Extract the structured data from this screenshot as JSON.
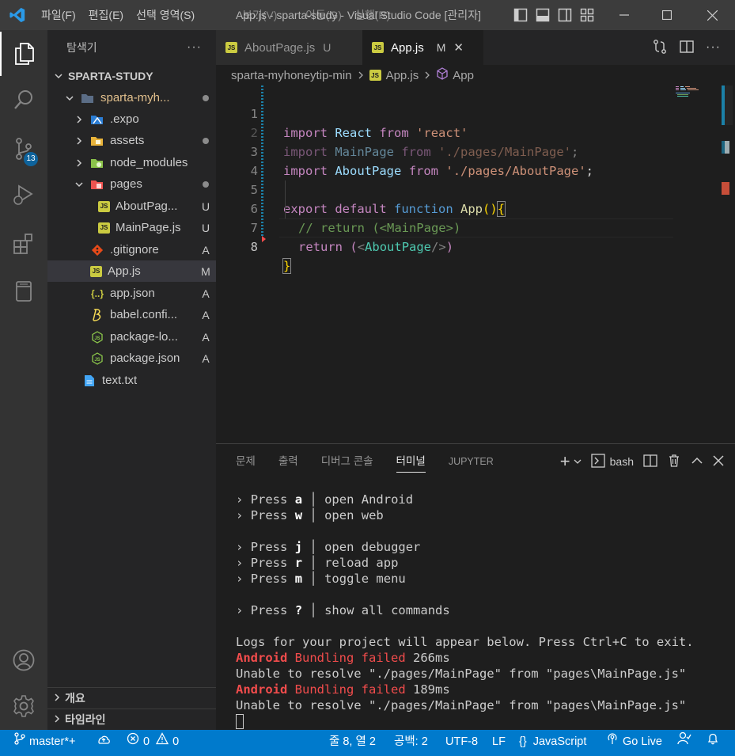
{
  "window": {
    "title": "App.js - sparta-study - Visual Studio Code [관리자]",
    "menu": [
      "파일(F)",
      "편집(E)",
      "선택 영역(S)",
      "보기(V)",
      "이동(G)",
      "실행(R)"
    ]
  },
  "activity_bar": {
    "source_control_badge": "13"
  },
  "explorer": {
    "header": "탐색기",
    "more": "···",
    "root": "SPARTA-STUDY",
    "items": [
      {
        "label": "sparta-myh...",
        "status": "",
        "dot": true
      },
      {
        "label": ".expo",
        "status": ""
      },
      {
        "label": "assets",
        "status": "",
        "dot": true
      },
      {
        "label": "node_modules",
        "status": ""
      },
      {
        "label": "pages",
        "status": "",
        "dot": true
      },
      {
        "label": "AboutPag...",
        "status": "U"
      },
      {
        "label": "MainPage.js",
        "status": "U"
      },
      {
        "label": ".gitignore",
        "status": "A"
      },
      {
        "label": "App.js",
        "status": "M"
      },
      {
        "label": "app.json",
        "status": "A"
      },
      {
        "label": "babel.confi...",
        "status": "A"
      },
      {
        "label": "package-lo...",
        "status": "A"
      },
      {
        "label": "package.json",
        "status": "A"
      },
      {
        "label": "text.txt",
        "status": ""
      }
    ],
    "outline": "개요",
    "timeline": "타임라인"
  },
  "tabs": [
    {
      "label": "AboutPage.js",
      "status": "U",
      "icon": "JS"
    },
    {
      "label": "App.js",
      "status": "M",
      "icon": "JS",
      "close": "✕"
    }
  ],
  "breadcrumb": {
    "folder": "sparta-myhoneytip-min",
    "file": "App.js",
    "symbol": "App"
  },
  "editor": {
    "line_numbers": [
      "1",
      "2",
      "3",
      "4",
      "5",
      "6",
      "7",
      "8"
    ],
    "lines": {
      "l1": {
        "kw": "import",
        "id": "React",
        "from": "from",
        "str": "'react'"
      },
      "l2": {
        "kw": "import",
        "id": "MainPage",
        "from": "from",
        "str": "'./pages/MainPage'",
        "end": ";"
      },
      "l3": {
        "kw": "import",
        "id": "AboutPage",
        "from": "from",
        "str": "'./pages/AboutPage'",
        "end": ";"
      },
      "l5": {
        "export": "export",
        "default": "default",
        "function": "function",
        "name": "App",
        "parens": "()",
        "brace": "{"
      },
      "l6": {
        "comment": "// return (<MainPage>)"
      },
      "l7": {
        "ret": "return",
        "open": "(",
        "lt": "<",
        "tag": "AboutPage",
        "close_tag": "/>",
        "close": ")"
      },
      "l8": {
        "brace": "}"
      }
    }
  },
  "panel": {
    "tabs": [
      "문제",
      "출력",
      "디버그 콘솔",
      "터미널",
      "JUPYTER"
    ],
    "active_tab": "터미널",
    "shell": "bash",
    "add": "+"
  },
  "terminal": {
    "menu": [
      {
        "key": "a",
        "text": "open Android"
      },
      {
        "key": "w",
        "text": "open web"
      },
      {
        "key": "j",
        "text": "open debugger"
      },
      {
        "key": "r",
        "text": "reload app"
      },
      {
        "key": "m",
        "text": "toggle menu"
      },
      {
        "key": "?",
        "text": "show all commands"
      }
    ],
    "arrow": "›",
    "press": "Press",
    "bar": "│",
    "logs_info": "Logs for your project will appear below. Press Ctrl+C to exit.",
    "log1": {
      "platform": "Android",
      "msg": "Bundling failed",
      "time": "266ms"
    },
    "err1": "Unable to resolve \"./pages/MainPage\" from \"pages\\MainPage.js\"",
    "log2": {
      "platform": "Android",
      "msg": "Bundling failed",
      "time": "189ms"
    },
    "err2": "Unable to resolve \"./pages/MainPage\" from \"pages\\MainPage.js\""
  },
  "statusbar": {
    "branch": "master*+",
    "errors": "0",
    "warnings": "0",
    "position": "줄 8, 열 2",
    "spaces": "공백: 2",
    "encoding": "UTF-8",
    "eol": "LF",
    "language": "JavaScript",
    "golive": "Go Live"
  },
  "colors": {
    "accent": "#007acc",
    "untracked": "#73c991",
    "modified": "#e2c08d",
    "error": "#f14c4c"
  }
}
